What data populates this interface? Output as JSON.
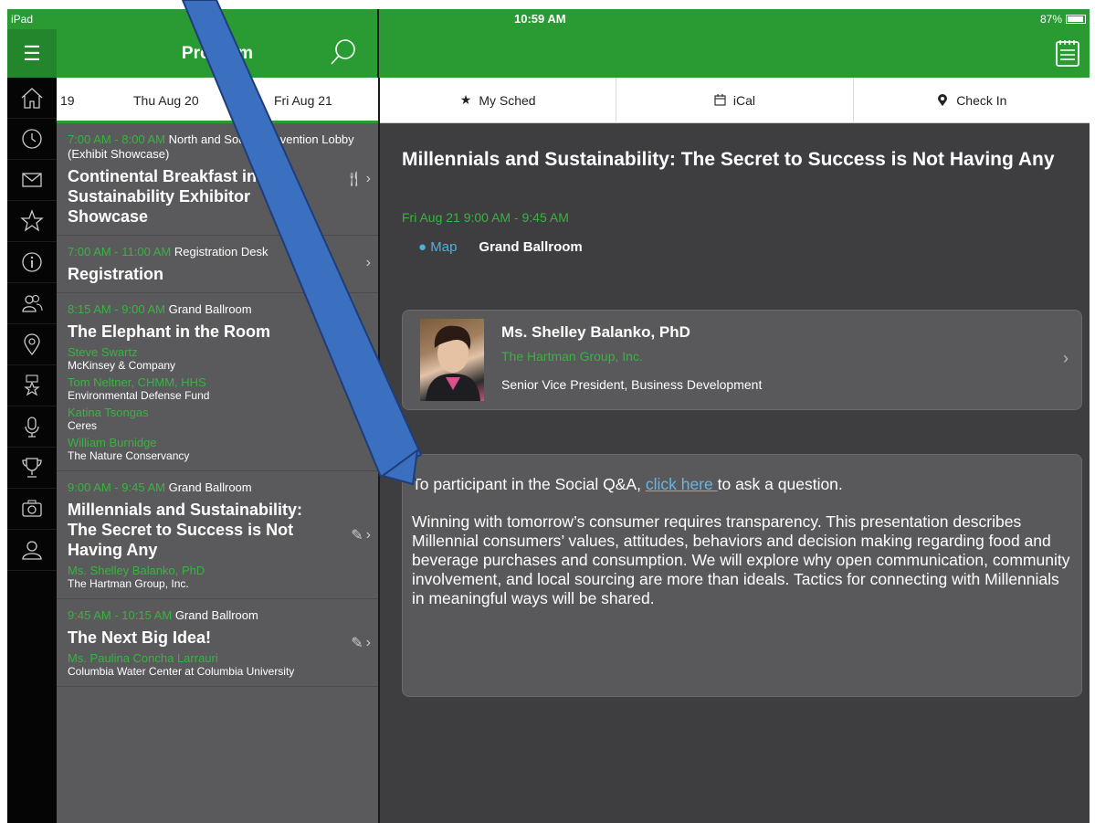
{
  "status_bar": {
    "carrier": "iPad",
    "time": "10:59 AM",
    "battery": "87%"
  },
  "header": {
    "title": "Program"
  },
  "days": [
    "19",
    "Thu  Aug 20",
    "Fri  Aug 21"
  ],
  "sessions": [
    {
      "time": "7:00 AM - 8:00 AM",
      "location": "North and South Convention Lobby (Exhibit Showcase)",
      "title": "Continental Breakfast in Sustainability Exhibitor Showcase",
      "icon": "fork-knife-icon",
      "speakers": []
    },
    {
      "time": "7:00 AM - 11:00 AM",
      "location": "Registration Desk",
      "title": "Registration",
      "icon": "",
      "speakers": []
    },
    {
      "time": "8:15 AM - 9:00 AM",
      "location": "Grand Ballroom",
      "title": "The Elephant in the Room",
      "icon": "pencil-icon",
      "speakers": [
        {
          "name": "Steve Swartz",
          "org": "McKinsey & Company"
        },
        {
          "name": "Tom Neltner, CHMM, HHS",
          "org": "Environmental Defense Fund"
        },
        {
          "name": "Katina Tsongas",
          "org": "Ceres"
        },
        {
          "name": "William Burnidge",
          "org": "The Nature Conservancy"
        }
      ]
    },
    {
      "time": "9:00 AM - 9:45 AM",
      "location": "Grand Ballroom",
      "title": "Millennials and Sustainability: The Secret to Success is Not Having Any",
      "icon": "pencil-icon",
      "speakers": [
        {
          "name": "Ms. Shelley Balanko, PhD",
          "org": "The Hartman Group, Inc."
        }
      ]
    },
    {
      "time": "9:45 AM - 10:15 AM",
      "location": "Grand Ballroom",
      "title": "The Next Big Idea!",
      "icon": "pencil-icon",
      "speakers": [
        {
          "name": "Ms. Paulina Concha Larrauri",
          "org": "Columbia Water Center at Columbia University"
        }
      ]
    }
  ],
  "tabs": [
    {
      "label": "My Sched",
      "icon": "star-icon"
    },
    {
      "label": "iCal",
      "icon": "calendar-icon"
    },
    {
      "label": "Check In",
      "icon": "check-in-icon"
    }
  ],
  "detail": {
    "title": "Millennials and Sustainability: The Secret to Success is Not Having Any",
    "datetime": "Fri Aug 21 9:00 AM - 9:45 AM",
    "map_label": "Map",
    "location": "Grand Ballroom",
    "speaker": {
      "name": "Ms. Shelley Balanko, PhD",
      "org": "The Hartman Group, Inc.",
      "role": "Senior Vice President, Business Development"
    },
    "qa_prefix": "To participant in the Social Q&A, ",
    "qa_link": "click here ",
    "qa_suffix": "to ask a question.",
    "description": "Winning with tomorrow’s consumer requires transparency.  This presentation describes Millennial consumers’ values, attitudes, behaviors and decision making regarding food and beverage purchases and consumption.  We will explore why open communication, community involvement, and local sourcing are more than ideals. Tactics for connecting with Millennials in meaningful ways will be shared."
  },
  "colors": {
    "accent": "#2a9a33",
    "speaker_green": "#37b43f",
    "link": "#66b6e8",
    "arrow": "#3b6fbf"
  }
}
